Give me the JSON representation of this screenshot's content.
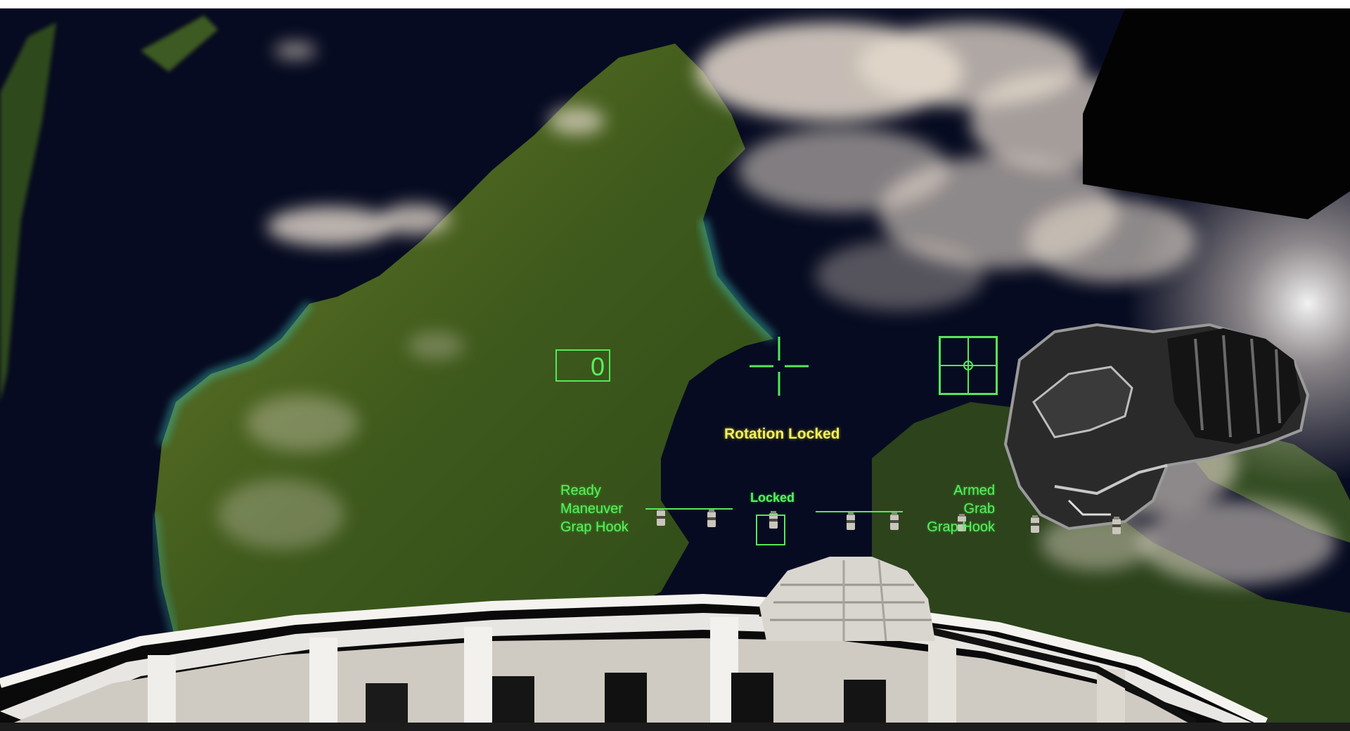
{
  "hud": {
    "counter": "0",
    "rotation_status": "Rotation Locked",
    "left_tool": {
      "lines": [
        "Ready",
        "Maneuver",
        "Grap Hook"
      ]
    },
    "center_tool": {
      "label": "Locked"
    },
    "right_tool": {
      "lines": [
        "Armed",
        "Grab",
        "Grap Hook"
      ]
    }
  },
  "colors": {
    "hud_green": "#56f25a",
    "status_yellow": "#f2f25a",
    "space": "#05060f",
    "cloud": "#e8ddd0",
    "land": "#3c5a1e"
  },
  "icons": {
    "crosshair": "crosshair-icon",
    "target": "target-reticle-icon",
    "canister": "canister-icon"
  }
}
